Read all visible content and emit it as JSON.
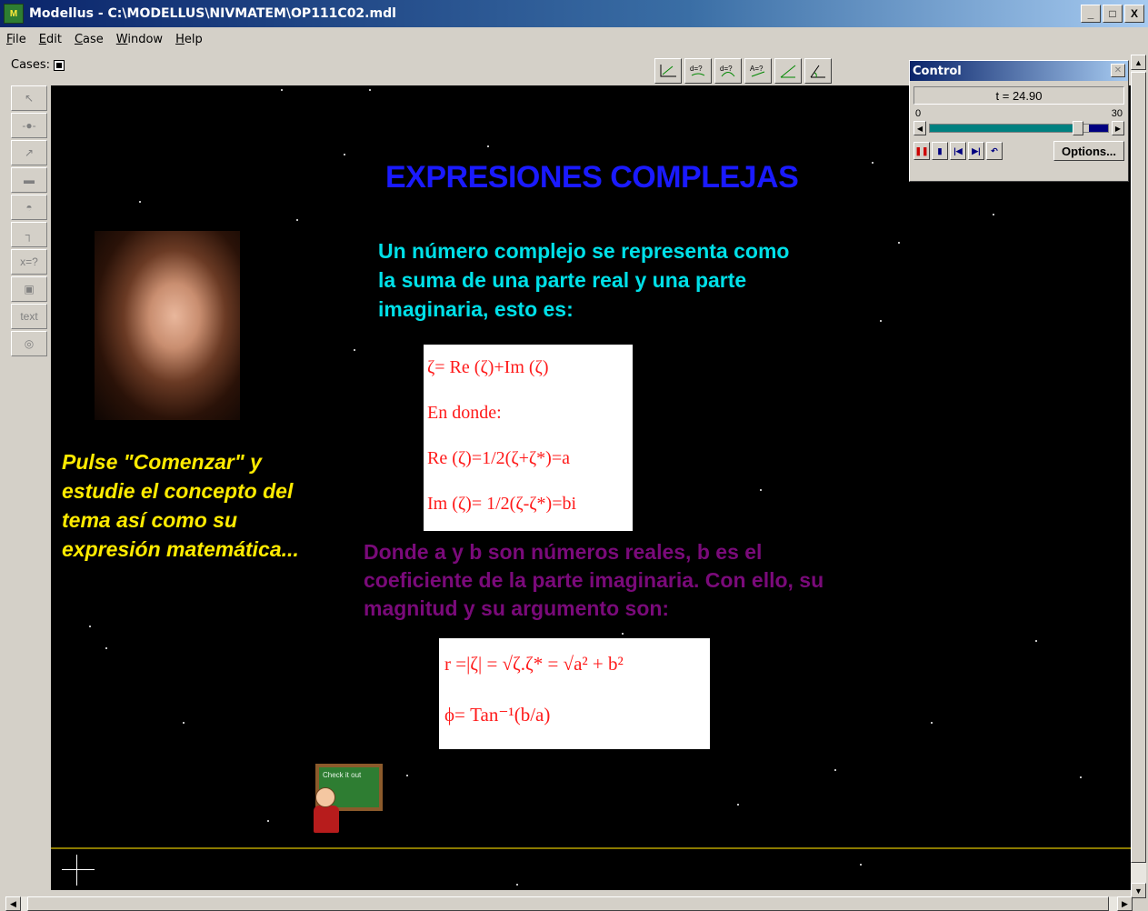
{
  "window": {
    "title": "Modellus - C:\\MODELLUS\\NIVMATEM\\OP111C02.mdl",
    "min": "_",
    "max": "□",
    "close": "X"
  },
  "menu": [
    {
      "key": "F",
      "rest": "ile"
    },
    {
      "key": "E",
      "rest": "dit"
    },
    {
      "key": "C",
      "rest": "ase"
    },
    {
      "key": "W",
      "rest": "indow"
    },
    {
      "key": "H",
      "rest": "elp"
    }
  ],
  "cases_label": "Cases:",
  "top_tools": [
    "graph-icon",
    "x-equals-icon",
    "dx-equals-icon",
    "a-equals-icon",
    "angle-icon",
    "angle-measure-icon"
  ],
  "left_tools": {
    "pointer": "↖",
    "particle": "-●-",
    "vector": "↗",
    "bar": "▬",
    "meter": "◓",
    "ruler": "┐",
    "xeq": "x=?",
    "image": "▣",
    "text": "text",
    "target": "◎"
  },
  "canvas": {
    "heading": "EXPRESIONES COMPLEJAS",
    "intro": "Un número complejo se representa como la suma de una parte real y una parte imaginaria, esto es:",
    "pulse": "Pulse \"Comenzar\" y estudie el concepto del tema así como su expresión matemática...",
    "formula1": {
      "line1": "ζ= Re (ζ)+Im (ζ)",
      "line2": "En donde:",
      "line3": "Re (ζ)=1/2(ζ+ζ*)=a",
      "line4": "Im (ζ)= 1/2(ζ-ζ*)=bi"
    },
    "donde": "Donde a y b son números reales, b es el coeficiente de la parte imaginaria. Con ello, su magnitud y su argumento son:",
    "formula2": {
      "line1": "r =|ζ| = √ζ.ζ* = √a² + b²",
      "line2": "ϕ= Tan⁻¹(b/a)"
    },
    "board_text": "Check it out"
  },
  "control": {
    "title": "Control",
    "time": "t = 24.90",
    "min": "0",
    "max": "30",
    "fraction": 0.83,
    "options": "Options..."
  }
}
